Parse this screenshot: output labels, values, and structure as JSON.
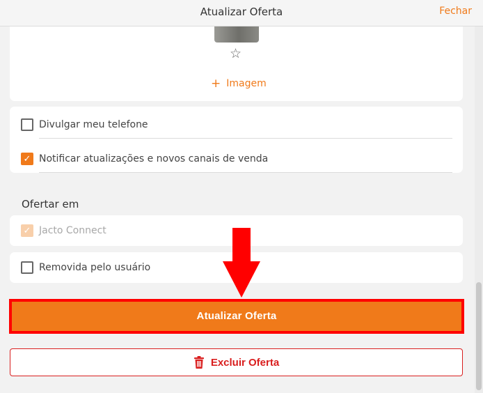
{
  "header": {
    "title": "Atualizar Oferta",
    "close_label": "Fechar"
  },
  "image_card": {
    "star_icon": "star-outline-icon",
    "add_image_label": "Imagem"
  },
  "options": [
    {
      "label": "Divulgar meu telefone",
      "checked": false
    },
    {
      "label": "Notificar atualizações e novos canais de venda",
      "checked": true
    }
  ],
  "offer_section": {
    "title": "Ofertar em",
    "channels": [
      {
        "label": "Jacto Connect",
        "checked": true,
        "disabled": true
      },
      {
        "label": "Removida pelo usuário",
        "checked": false,
        "disabled": false
      }
    ]
  },
  "actions": {
    "update_label": "Atualizar Oferta",
    "delete_label": "Excluir Oferta"
  },
  "colors": {
    "accent": "#f07a1a",
    "highlight": "#ff0000",
    "danger": "#d91e1e"
  }
}
